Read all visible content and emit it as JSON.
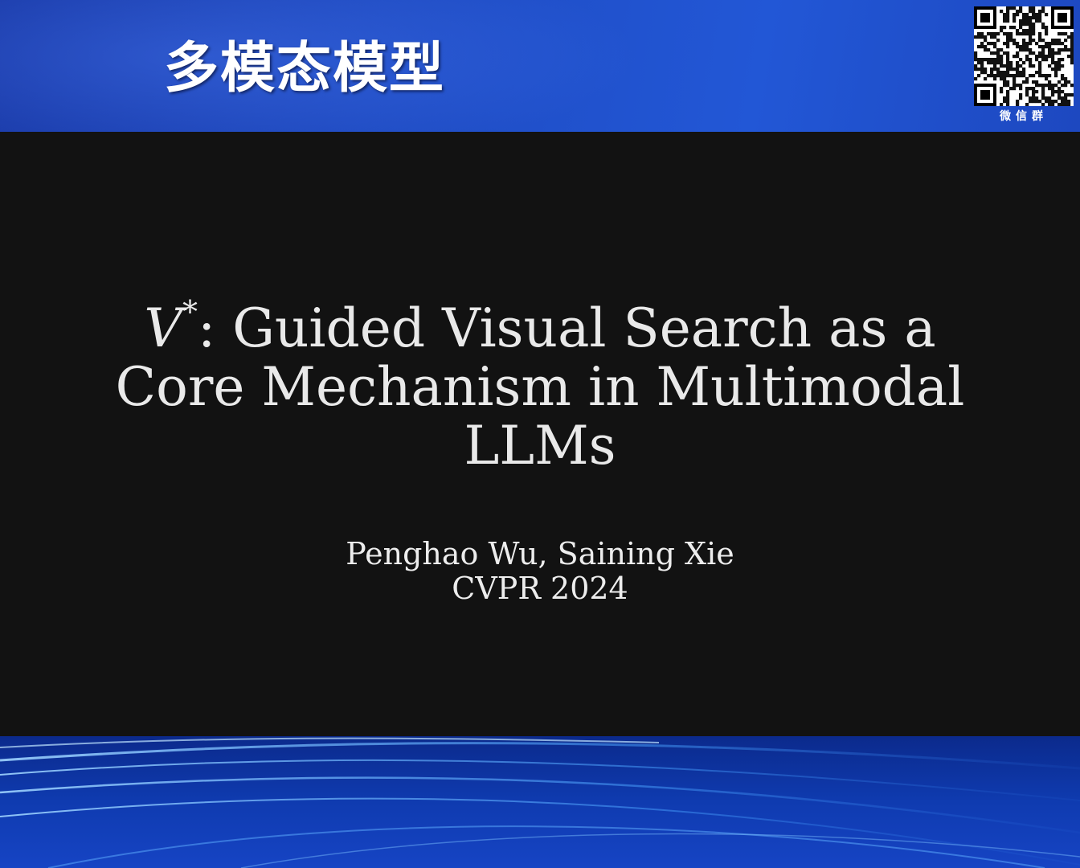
{
  "banner": {
    "title": "多模态模型"
  },
  "qr": {
    "label": "微信群"
  },
  "slide": {
    "title_symbol": "V",
    "title_symbol_sup": "*",
    "title_line1_rest": ": Guided Visual Search as a",
    "title_line2": "Core Mechanism in Multimodal",
    "title_line3": "LLMs",
    "authors": "Penghao Wu, Saining Xie",
    "venue": "CVPR 2024"
  },
  "colors": {
    "banner_blue": "#1f4bc2",
    "slide_background": "#121212",
    "slide_text": "#e9e9e9"
  }
}
